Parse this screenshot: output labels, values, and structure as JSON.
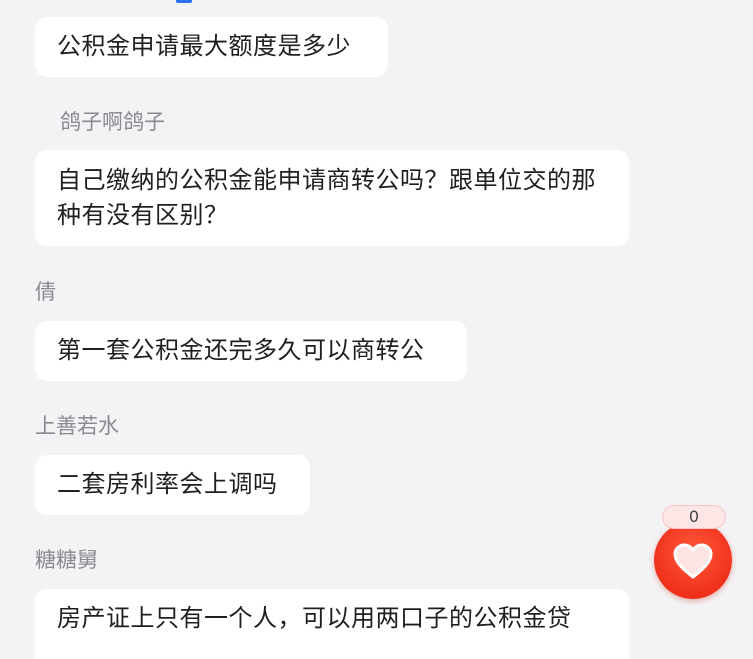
{
  "messages": [
    {
      "author": "",
      "text": "公积金申请最大额度是多少"
    },
    {
      "author": "鸽子啊鸽子",
      "text": "自己缴纳的公积金能申请商转公吗？跟单位交的那种有没有区别？"
    },
    {
      "author": "倩",
      "text": "第一套公积金还完多久可以商转公"
    },
    {
      "author": "上善若水",
      "text": "二套房利率会上调吗"
    },
    {
      "author": "糖糖舅",
      "text": "房产证上只有一个人，可以用两口子的公积金贷"
    }
  ],
  "like": {
    "count": "0",
    "icon": "heart-icon"
  },
  "colors": {
    "background": "#f3f3f5",
    "bubble": "#ffffff",
    "name_text": "#8a8a8f",
    "like_button": "#f0301b",
    "like_badge": "#fde6e6",
    "accent": "#2f6ff2"
  }
}
